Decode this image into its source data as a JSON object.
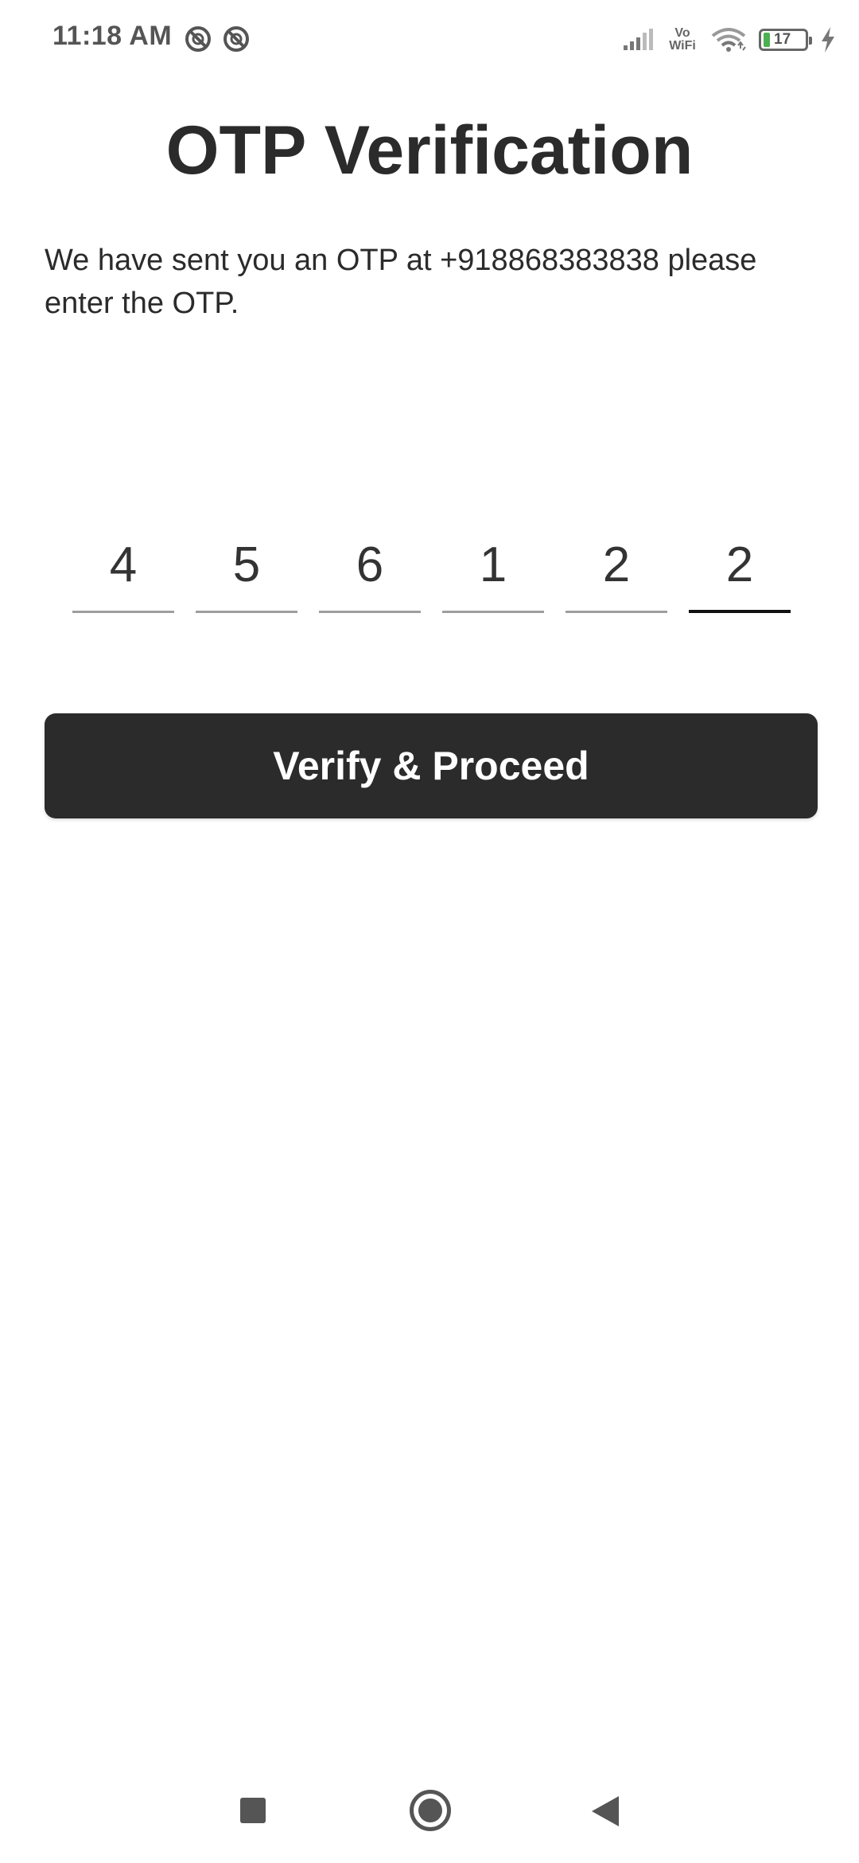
{
  "status_bar": {
    "time": "11:18 AM",
    "left_icons": [
      "do-not-disturb-icon",
      "do-not-disturb-icon"
    ],
    "vowifi_top": "Vo",
    "vowifi_bottom": "WiFi",
    "battery_level": "17",
    "charging": true
  },
  "page": {
    "title": "OTP Verification",
    "message": "We have sent you an OTP at +918868383838 please enter the OTP."
  },
  "otp": {
    "digits": [
      "4",
      "5",
      "6",
      "1",
      "2",
      "2"
    ],
    "active_index": 5
  },
  "actions": {
    "verify_label": "Verify & Proceed"
  },
  "nav_bar": {
    "buttons": [
      "recent-apps",
      "home",
      "back"
    ]
  },
  "colors": {
    "primary": "#2b2b2b",
    "otp_underline": "#9e9e9e",
    "otp_active_underline": "#111111",
    "battery_fill": "#4caf50"
  }
}
